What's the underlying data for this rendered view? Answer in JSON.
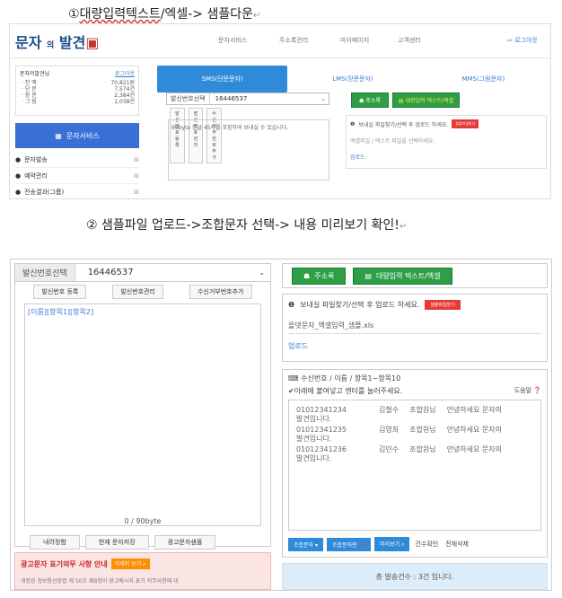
{
  "captions": {
    "step1_num": "①",
    "step1_a": "대량입력텍스트",
    "step1_b": "/엑셀-> 샘플다운",
    "step2": "② 샘플파일 업로드->조합문자 선택-> 내용 미리보기 확인!",
    "return_mark": "↵"
  },
  "shot1": {
    "logo_a": "문자",
    "logo_b": "의",
    "logo_c": "발견",
    "nav": [
      "문자서비스",
      "주소록관리",
      "마이페이지",
      "고객센터"
    ],
    "logout": "로그아웃",
    "user": {
      "name": "문자의발견님",
      "logout": "로그아웃",
      "rows": [
        {
          "label": "· 잔 액",
          "value": "70,821원"
        },
        {
          "label": "· 단 문",
          "value": "7,574건"
        },
        {
          "label": "· 장 문",
          "value": "2,384건"
        },
        {
          "label": "· 그 림",
          "value": "1,038건"
        }
      ]
    },
    "service_title": "문자서비스",
    "menu": [
      "문자발송",
      "예약관리",
      "전송결과(그룹)"
    ],
    "tabs": [
      "SMS(단문문자)",
      "LMS(장문문자)",
      "MMS(그림문자)"
    ],
    "sender_label": "발신번호선택",
    "sender_number": "16446537",
    "sender_btns": [
      "발신번호 등록",
      "발신번호관리",
      "수신거부번호추가"
    ],
    "textarea": "90byte 한글 45자를 포함하여 보내실 수 있습니다.",
    "addr_btn": "주소록",
    "bulk_btn": "대량입력 텍스트/엑셀",
    "upload_msg": "보내실 파일찾기/선택 후 업로드 하세요.",
    "sample_btn": "샘플파일받기",
    "file_hint": "엑셀파일 / 텍스트 파일을 선택하세요.",
    "upload": "업로드"
  },
  "shot2": {
    "sender_label": "발신번호선택",
    "sender_number": "16446537",
    "sender_btns": [
      "발신번호 등록",
      "발신번호관리",
      "수신거부번호추가"
    ],
    "textarea": "[이름][항목1][항목2]",
    "bytes": "0 / 90byte",
    "bottom_btns": [
      "내려정함",
      "현재 문자저장",
      "광고문자샘플"
    ],
    "ad_title": "광고문자 표기의무 사항 안내",
    "ad_btn": "자세히 보기",
    "ad_desc": "개정된 정보통신망법 제 50조 제8항이 광고메시지 표기 의무사항에 대",
    "addr_btn": "주소록",
    "bulk_btn": "대량입력 텍스트/엑셀",
    "upload_msg": "보내실 파일찾기/선택 후 업로드 하세요.",
    "sample_btn": "샘플파일받기",
    "file_name": "을댓문자_엑셀입력_샘플.xls",
    "upload": "업로드",
    "recv_title": "수신번호 / 이름 / 항목1~항목10",
    "recv_hint": "✔아래에 붙여넣고 엔터를 눌러주세요.",
    "help": "도움말",
    "rows": [
      {
        "num": "01012341234",
        "name": "김철수",
        "a": "조합원님",
        "b": "안녕하세요 문자의",
        "wrap": "발견입니다."
      },
      {
        "num": "01012341235",
        "name": "김영희",
        "a": "조합원님",
        "b": "안녕하세요 문자의",
        "wrap": "발견입니다."
      },
      {
        "num": "01012341236",
        "name": "김민수",
        "a": "조합원님",
        "b": "안녕하세요 문자의",
        "wrap": "발견입니다."
      }
    ],
    "combo_btn": "조합문자",
    "combo_guide": "조합문자란",
    "preview": "미리보기",
    "count_check": "건수확인",
    "delete_all": "전체삭제",
    "total": "총 발송건수 : 3건 입니다."
  }
}
